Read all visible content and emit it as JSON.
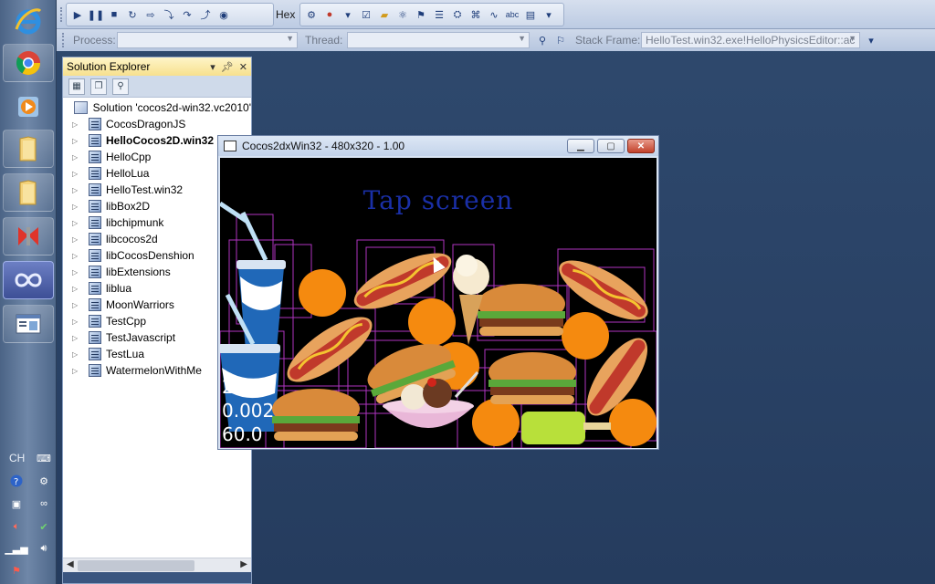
{
  "toolbar": {
    "hex_label": "Hex",
    "process_label": "Process:",
    "process_value": "",
    "thread_label": "Thread:",
    "thread_value": "",
    "stack_frame_label": "Stack Frame:",
    "stack_frame_value": "HelloTest.win32.exe!HelloPhysicsEditor::ac"
  },
  "taskbar": {
    "tray_lang": "CH"
  },
  "solution_explorer": {
    "title": "Solution Explorer",
    "solution_label": "Solution 'cocos2d-win32.vc2010'",
    "projects": [
      {
        "label": "CocosDragonJS",
        "bold": false
      },
      {
        "label": "HelloCocos2D.win32",
        "bold": true
      },
      {
        "label": "HelloCpp",
        "bold": false
      },
      {
        "label": "HelloLua",
        "bold": false
      },
      {
        "label": "HelloTest.win32",
        "bold": false
      },
      {
        "label": "libBox2D",
        "bold": false
      },
      {
        "label": "libchipmunk",
        "bold": false
      },
      {
        "label": "libcocos2d",
        "bold": false
      },
      {
        "label": "libCocosDenshion",
        "bold": false
      },
      {
        "label": "libExtensions",
        "bold": false
      },
      {
        "label": "liblua",
        "bold": false
      },
      {
        "label": "MoonWarriors",
        "bold": false
      },
      {
        "label": "TestCpp",
        "bold": false
      },
      {
        "label": "TestJavascript",
        "bold": false
      },
      {
        "label": "TestLua",
        "bold": false
      },
      {
        "label": "WatermelonWithMe",
        "bold": false
      }
    ]
  },
  "game_window": {
    "title": "Cocos2dxWin32 - 480x320 - 1.00",
    "tap_text": "Tap screen",
    "stats": [
      "284",
      "0.002",
      "60.0"
    ]
  },
  "colors": {
    "desktop": "#2b4468",
    "tap_text": "#1a2fa6",
    "debug_box": "#c23ad6"
  }
}
